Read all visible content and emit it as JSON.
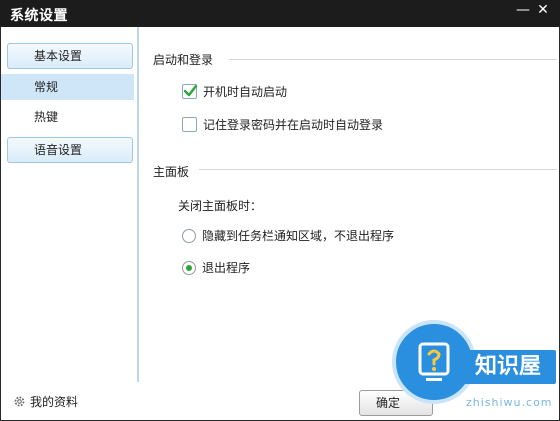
{
  "window": {
    "title": "系统设置",
    "minimize_glyph": "—",
    "close_glyph": "✕"
  },
  "sidebar": {
    "basic_group": "基本设置",
    "items": [
      {
        "label": "常规",
        "active": true
      },
      {
        "label": "热键",
        "active": false
      }
    ],
    "voice_group": "语音设置"
  },
  "sections": {
    "startup": {
      "title": "启动和登录",
      "options": [
        {
          "label": "开机时自动启动",
          "checked": true
        },
        {
          "label": "记住登录密码并在启动时自动登录",
          "checked": false
        }
      ]
    },
    "main_panel": {
      "title": "主面板",
      "close_label": "关闭主面板时：",
      "options": [
        {
          "label": "隐藏到任务栏通知区域，不退出程序",
          "selected": false
        },
        {
          "label": "退出程序",
          "selected": true
        }
      ]
    }
  },
  "bottom": {
    "profile_label": "我的资料",
    "ok_label": "确定"
  },
  "watermark": {
    "brand": "知识屋",
    "url": "zhishiwu.com"
  },
  "colors": {
    "accent": "#2ba53a",
    "titlebar": "#1c1c1c",
    "selected_row": "#cfe6f8",
    "watermark": "#2b8fe0"
  }
}
